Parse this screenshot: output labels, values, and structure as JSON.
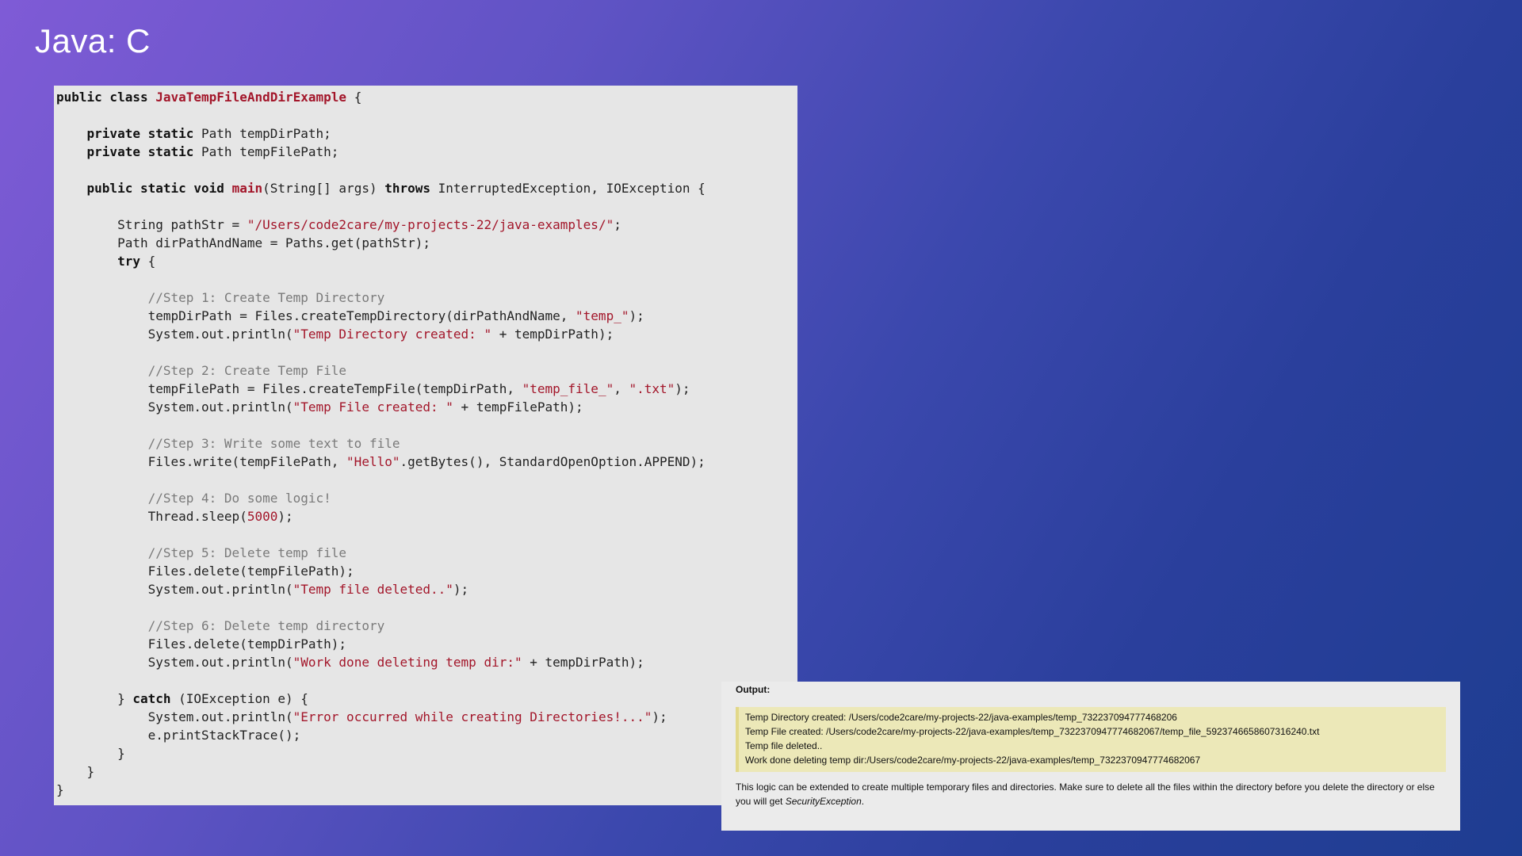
{
  "slide": {
    "title": "Java: C"
  },
  "code": {
    "lines": [
      [
        [
          "kw",
          "public class "
        ],
        [
          "cls",
          "JavaTempFileAndDirExample"
        ],
        [
          "p",
          " {"
        ]
      ],
      [],
      [
        [
          "p",
          "    "
        ],
        [
          "kw",
          "private static "
        ],
        [
          "p",
          "Path tempDirPath;"
        ]
      ],
      [
        [
          "p",
          "    "
        ],
        [
          "kw",
          "private static "
        ],
        [
          "p",
          "Path tempFilePath;"
        ]
      ],
      [],
      [
        [
          "p",
          "    "
        ],
        [
          "kw",
          "public static void "
        ],
        [
          "cls",
          "main"
        ],
        [
          "p",
          "(String[] args) "
        ],
        [
          "kw",
          "throws "
        ],
        [
          "p",
          "InterruptedException, IOException {"
        ]
      ],
      [],
      [
        [
          "p",
          "        String pathStr = "
        ],
        [
          "str",
          "\"/Users/code2care/my-projects-22/java-examples/\""
        ],
        [
          "p",
          ";"
        ]
      ],
      [
        [
          "p",
          "        Path dirPathAndName = Paths.get(pathStr);"
        ]
      ],
      [
        [
          "p",
          "        "
        ],
        [
          "kw",
          "try "
        ],
        [
          "p",
          "{"
        ]
      ],
      [],
      [
        [
          "p",
          "            "
        ],
        [
          "cm",
          "//Step 1: Create Temp Directory"
        ]
      ],
      [
        [
          "p",
          "            tempDirPath = Files.createTempDirectory(dirPathAndName, "
        ],
        [
          "str",
          "\"temp_\""
        ],
        [
          "p",
          ");"
        ]
      ],
      [
        [
          "p",
          "            System.out.println("
        ],
        [
          "str",
          "\"Temp Directory created: \""
        ],
        [
          "p",
          " + tempDirPath);"
        ]
      ],
      [],
      [
        [
          "p",
          "            "
        ],
        [
          "cm",
          "//Step 2: Create Temp File"
        ]
      ],
      [
        [
          "p",
          "            tempFilePath = Files.createTempFile(tempDirPath, "
        ],
        [
          "str",
          "\"temp_file_\""
        ],
        [
          "p",
          ", "
        ],
        [
          "str",
          "\".txt\""
        ],
        [
          "p",
          ");"
        ]
      ],
      [
        [
          "p",
          "            System.out.println("
        ],
        [
          "str",
          "\"Temp File created: \""
        ],
        [
          "p",
          " + tempFilePath);"
        ]
      ],
      [],
      [
        [
          "p",
          "            "
        ],
        [
          "cm",
          "//Step 3: Write some text to file"
        ]
      ],
      [
        [
          "p",
          "            Files.write(tempFilePath, "
        ],
        [
          "str",
          "\"Hello\""
        ],
        [
          "p",
          ".getBytes(), StandardOpenOption.APPEND);"
        ]
      ],
      [],
      [
        [
          "p",
          "            "
        ],
        [
          "cm",
          "//Step 4: Do some logic!"
        ]
      ],
      [
        [
          "p",
          "            Thread.sleep("
        ],
        [
          "num",
          "5000"
        ],
        [
          "p",
          ");"
        ]
      ],
      [],
      [
        [
          "p",
          "            "
        ],
        [
          "cm",
          "//Step 5: Delete temp file"
        ]
      ],
      [
        [
          "p",
          "            Files.delete(tempFilePath);"
        ]
      ],
      [
        [
          "p",
          "            System.out.println("
        ],
        [
          "str",
          "\"Temp file deleted..\""
        ],
        [
          "p",
          ");"
        ]
      ],
      [],
      [
        [
          "p",
          "            "
        ],
        [
          "cm",
          "//Step 6: Delete temp directory"
        ]
      ],
      [
        [
          "p",
          "            Files.delete(tempDirPath);"
        ]
      ],
      [
        [
          "p",
          "            System.out.println("
        ],
        [
          "str",
          "\"Work done deleting temp dir:\""
        ],
        [
          "p",
          " + tempDirPath);"
        ]
      ],
      [],
      [
        [
          "p",
          "        } "
        ],
        [
          "kw",
          "catch "
        ],
        [
          "p",
          "(IOException e) {"
        ]
      ],
      [
        [
          "p",
          "            System.out.println("
        ],
        [
          "str",
          "\"Error occurred while creating Directories!...\""
        ],
        [
          "p",
          ");"
        ]
      ],
      [
        [
          "p",
          "            e.printStackTrace();"
        ]
      ],
      [
        [
          "p",
          "        }"
        ]
      ],
      [
        [
          "p",
          "    }"
        ]
      ],
      [
        [
          "p",
          "}"
        ]
      ]
    ]
  },
  "output": {
    "label": "Output:",
    "lines": [
      "Temp Directory created: /Users/code2care/my-projects-22/java-examples/temp_732237094777468206",
      "Temp File created: /Users/code2care/my-projects-22/java-examples/temp_7322370947774682067/temp_file_5923746658607316240.txt",
      "Temp file deleted..",
      "Work done deleting temp dir:/Users/code2care/my-projects-22/java-examples/temp_7322370947774682067"
    ],
    "note_text": "This logic can be extended to create multiple temporary files and directories. Make sure to delete all the files within the directory before you delete the directory or else you will get ",
    "note_emphasis": "SecurityException",
    "note_end": "."
  }
}
